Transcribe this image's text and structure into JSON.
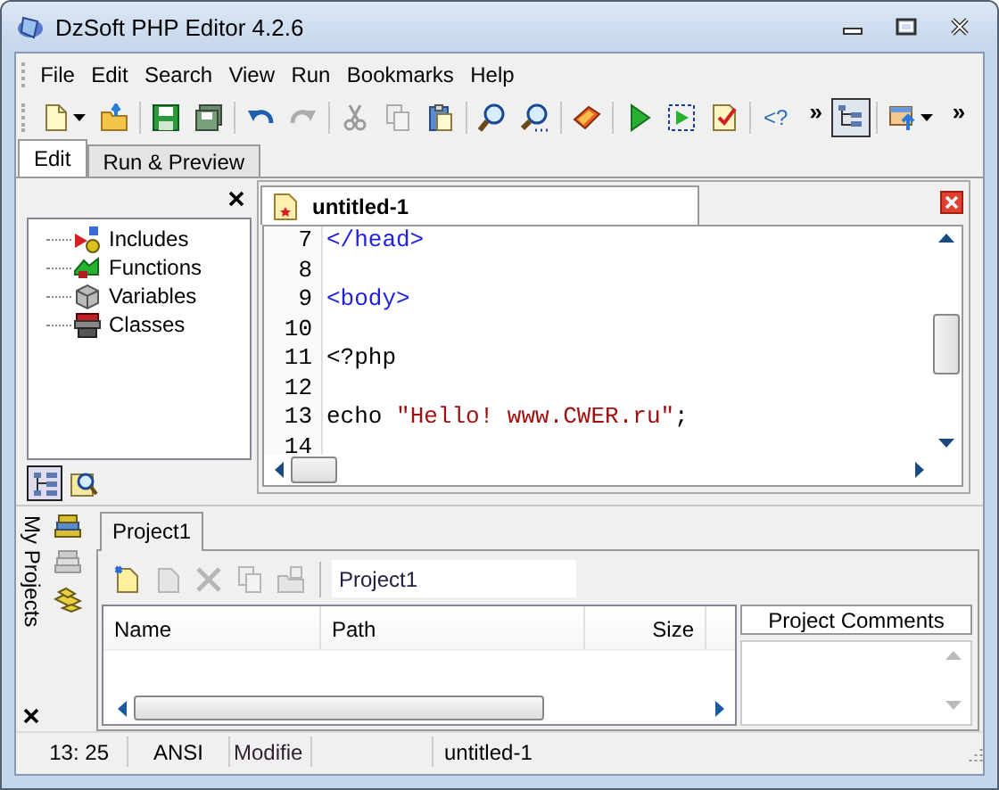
{
  "window": {
    "title": "DzSoft PHP Editor 4.2.6"
  },
  "menu": [
    "File",
    "Edit",
    "Search",
    "View",
    "Run",
    "Bookmarks",
    "Help"
  ],
  "toolbar": [
    {
      "kind": "dropdown",
      "disabled": false
    },
    {
      "kind": "button",
      "disabled": false
    },
    {
      "kind": "separator"
    },
    {
      "kind": "button",
      "disabled": false
    },
    {
      "kind": "button",
      "disabled": false
    },
    {
      "kind": "separator"
    },
    {
      "kind": "button",
      "disabled": false
    },
    {
      "kind": "button",
      "disabled": true
    },
    {
      "kind": "separator"
    },
    {
      "kind": "button",
      "disabled": true
    },
    {
      "kind": "button",
      "disabled": true
    },
    {
      "kind": "button",
      "disabled": false
    },
    {
      "kind": "separator"
    },
    {
      "kind": "button",
      "disabled": false
    },
    {
      "kind": "button",
      "disabled": false
    },
    {
      "kind": "separator"
    },
    {
      "kind": "button",
      "disabled": false
    },
    {
      "kind": "separator"
    },
    {
      "kind": "button",
      "disabled": false
    },
    {
      "kind": "button",
      "disabled": false
    },
    {
      "kind": "button",
      "disabled": false
    },
    {
      "kind": "separator"
    },
    {
      "kind": "text",
      "label": "<?"
    },
    {
      "kind": "chevron",
      "label": "»"
    },
    {
      "kind": "toggle",
      "pressed": true
    },
    {
      "kind": "separator"
    },
    {
      "kind": "dropdown",
      "disabled": false
    },
    {
      "kind": "chevron",
      "label": "»"
    }
  ],
  "panel_tabs": [
    {
      "label": "Edit",
      "selected": true
    },
    {
      "label": "Run & Preview",
      "selected": false
    }
  ],
  "outline": {
    "items": [
      {
        "label": "Includes"
      },
      {
        "label": "Functions"
      },
      {
        "label": "Variables"
      },
      {
        "label": "Classes"
      }
    ],
    "views": [
      {
        "selected": true
      },
      {
        "selected": false
      }
    ]
  },
  "editor": {
    "tab": {
      "label": "untitled-1"
    },
    "lines": [
      {
        "number": "7",
        "tokens": [
          {
            "kind": "tag",
            "text": "</head>"
          }
        ]
      },
      {
        "number": "8"
      },
      {
        "number": "9",
        "tokens": [
          {
            "kind": "tag",
            "text": "<body>"
          }
        ]
      },
      {
        "number": "10"
      },
      {
        "number": "11",
        "tokens": [
          {
            "kind": "plain",
            "text": "<?php"
          }
        ]
      },
      {
        "number": "12"
      },
      {
        "number": "13",
        "tokens": [
          {
            "kind": "plain",
            "text": "echo "
          },
          {
            "kind": "string",
            "text": "\"Hello! www.CWER.ru\""
          },
          {
            "kind": "plain",
            "text": ";"
          }
        ]
      },
      {
        "number": "14"
      }
    ]
  },
  "projects": {
    "sidebar_label": "My Projects",
    "tabs": [
      {
        "label": "Project1",
        "selected": true
      }
    ],
    "tools": [
      {
        "disabled": false
      },
      {
        "disabled": true
      },
      {
        "disabled": true
      },
      {
        "disabled": true
      },
      {
        "disabled": true
      }
    ],
    "name_field": {
      "value": "Project1"
    },
    "columns": [
      "Name",
      "Path",
      "Size"
    ],
    "comments_header": "Project Comments"
  },
  "status_bar": {
    "position": "13: 25",
    "encoding": "ANSI",
    "state": "Modifie",
    "file": "untitled-1"
  }
}
